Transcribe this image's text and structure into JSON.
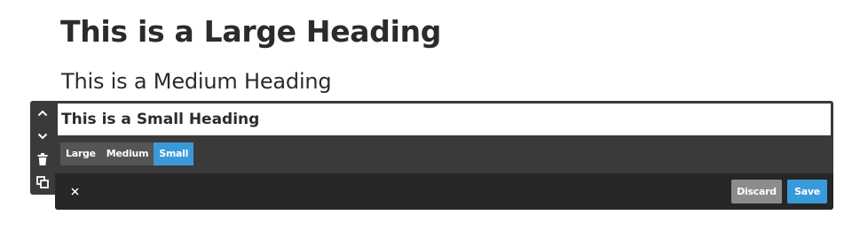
{
  "content": {
    "large_heading": "This is a Large Heading",
    "medium_heading": "This is a Medium Heading"
  },
  "side_toolbar": {
    "items": [
      {
        "icon": "chevron-up-icon"
      },
      {
        "icon": "chevron-down-icon"
      },
      {
        "icon": "trash-icon"
      },
      {
        "icon": "copy-icon"
      }
    ]
  },
  "editor": {
    "input_value": "This is a Small Heading",
    "size_options": [
      "Large",
      "Medium",
      "Small"
    ],
    "selected_size": "Small",
    "close_icon": "close-icon",
    "discard_label": "Discard",
    "save_label": "Save"
  },
  "colors": {
    "accent": "#3a9ad9",
    "toolbar_bg": "#3a3a3a",
    "footer_bg": "#262626",
    "discard_bg": "#8c8c8c"
  }
}
